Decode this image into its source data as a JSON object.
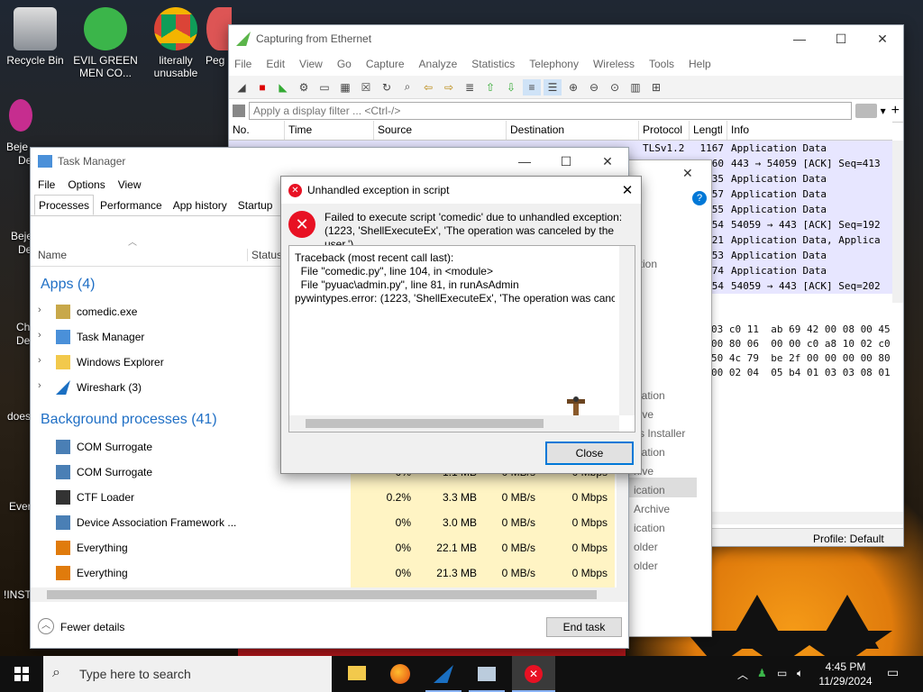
{
  "desktop": {
    "icons": [
      {
        "label": "Recycle Bin"
      },
      {
        "label": "EVIL GREEN MEN CO..."
      },
      {
        "label": "literally unusable"
      },
      {
        "label": "Peg"
      }
    ],
    "edge_labels": [
      "Beje",
      "De",
      "Beje",
      "De",
      "Ch",
      "De",
      "does",
      "Ever",
      "!INST"
    ]
  },
  "wireshark": {
    "title": "Capturing from Ethernet",
    "menu": [
      "File",
      "Edit",
      "View",
      "Go",
      "Capture",
      "Analyze",
      "Statistics",
      "Telephony",
      "Wireless",
      "Tools",
      "Help"
    ],
    "filter_placeholder": "Apply a display filter ... <Ctrl-/>",
    "columns": [
      "No.",
      "Time",
      "Source",
      "Destination",
      "Protocol",
      "Lengtl",
      "Info"
    ],
    "rows": [
      {
        "proto": "TLSv1.2",
        "len": "1167",
        "info": "Application Data"
      },
      {
        "proto": "",
        "len": "60",
        "info": "443 → 54059 [ACK] Seq=413"
      },
      {
        "proto": "",
        "len": "35",
        "info": "Application Data"
      },
      {
        "proto": "",
        "len": "57",
        "info": "Application Data"
      },
      {
        "proto": "",
        "len": "55",
        "info": "Application Data"
      },
      {
        "proto": "",
        "len": "54",
        "info": "54059 → 443 [ACK] Seq=192"
      },
      {
        "proto": "",
        "len": "21",
        "info": "Application Data, Applica"
      },
      {
        "proto": "",
        "len": "53",
        "info": "Application Data"
      },
      {
        "proto": "",
        "len": "74",
        "info": "Application Data"
      },
      {
        "proto": "",
        "len": "54",
        "info": "54059 → 443 [ACK] Seq=202"
      }
    ],
    "hex_lines": [
      "03 c0 11  ab 69 42 00 08 00 45",
      "00 80 06  00 00 c0 a8 10 02 c0",
      "50 4c 79  be 2f 00 00 00 00 80",
      "00 02 04  05 b4 01 03 03 08 01"
    ],
    "status_profile": "Profile: Default"
  },
  "bg_dialog": {
    "items": [
      "ation",
      "ication",
      "hive",
      "vs Installer",
      "ication",
      "hive",
      "ication",
      "Archive",
      "ication",
      "older",
      "older"
    ]
  },
  "task_manager": {
    "title": "Task Manager",
    "menu": [
      "File",
      "Options",
      "View"
    ],
    "tabs": [
      "Processes",
      "Performance",
      "App history",
      "Startup",
      "U"
    ],
    "col_name": "Name",
    "col_status": "Status",
    "apps_header": "Apps (4)",
    "apps": [
      {
        "name": "comedic.exe"
      },
      {
        "name": "Task Manager"
      },
      {
        "name": "Windows Explorer"
      },
      {
        "name": "Wireshark (3)"
      }
    ],
    "bg_header": "Background processes (41)",
    "bg_procs": [
      {
        "name": "COM Surrogate",
        "cpu": "",
        "mem": "",
        "disk": "",
        "net": ""
      },
      {
        "name": "COM Surrogate",
        "cpu": "0%",
        "mem": "1.1 MB",
        "disk": "0 MB/s",
        "net": "0 Mbps"
      },
      {
        "name": "CTF Loader",
        "cpu": "0.2%",
        "mem": "3.3 MB",
        "disk": "0 MB/s",
        "net": "0 Mbps"
      },
      {
        "name": "Device Association Framework ...",
        "cpu": "0%",
        "mem": "3.0 MB",
        "disk": "0 MB/s",
        "net": "0 Mbps"
      },
      {
        "name": "Everything",
        "cpu": "0%",
        "mem": "22.1 MB",
        "disk": "0 MB/s",
        "net": "0 Mbps"
      },
      {
        "name": "Everything",
        "cpu": "0%",
        "mem": "21.3 MB",
        "disk": "0 MB/s",
        "net": "0 Mbps"
      }
    ],
    "fewer_details": "Fewer details",
    "end_task": "End task"
  },
  "error_dialog": {
    "title": "Unhandled exception in script",
    "message": "Failed to execute script 'comedic' due to unhandled exception: (1223, 'ShellExecuteEx', 'The operation was canceled by the user.')",
    "traceback": "Traceback (most recent call last):\n  File \"comedic.py\", line 104, in <module>\n  File \"pyuac\\admin.py\", line 81, in runAsAdmin\npywintypes.error: (1223, 'ShellExecuteEx', 'The operation was cancel",
    "close_label": "Close"
  },
  "taskbar": {
    "search_placeholder": "Type here to search",
    "time": "4:45 PM",
    "date": "11/29/2024"
  },
  "colors": {
    "accent": "#0078d7",
    "error_red": "#e81123",
    "wireshark_row": "#e7e6ff",
    "metric_bg": "#fff4c4",
    "group_blue": "#1f6fc5"
  }
}
